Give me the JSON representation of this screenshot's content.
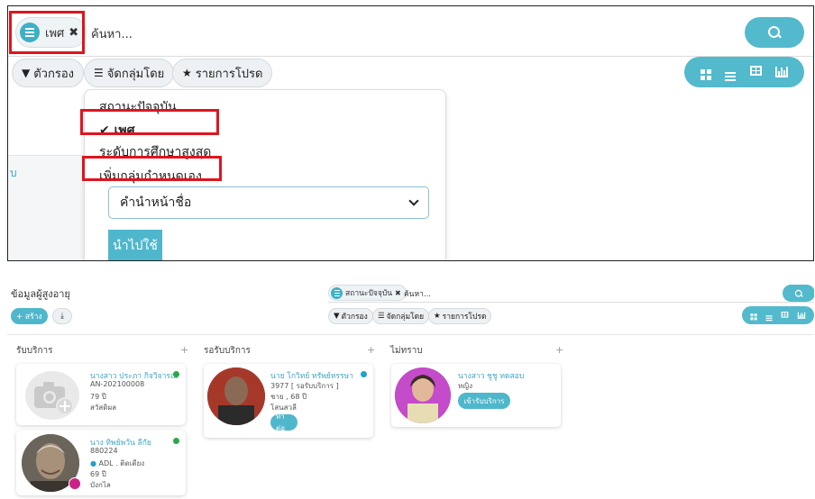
{
  "top": {
    "chip_label": "เพศ",
    "chip_remove": "✖",
    "search_placeholder": "ค้นหา...",
    "filter_label": "ตัวกรอง",
    "group_label": "จัดกลุ่มโดย",
    "favorite_label": "รายการโปรด",
    "side_fragment": "บ",
    "dropdown": {
      "items": [
        "สถานะปัจจุบัน",
        "เพศ",
        "ระดับการศึกษาสูงสุด",
        "เพิ่มกลุ่มกำหนดเอง"
      ],
      "checked_mark": "✔",
      "select_value": "คำนำหน้าชื่อ",
      "apply_label": "นำไปใช้"
    }
  },
  "bottom": {
    "title": "ข้อมูลผู้สูงอายุ",
    "chip_label": "สถานะปัจจุบัน",
    "chip_remove": "✖",
    "search_placeholder": "ค้นหา...",
    "create_label": "+ สร้าง",
    "download_icon": "⤓",
    "filter_label": "ตัวกรอง",
    "group_label": "จัดกลุ่มโดย",
    "favorite_label": "รายการโปรด",
    "columns": [
      {
        "title": "รับบริการ",
        "plus": "+"
      },
      {
        "title": "รอรับบริการ",
        "plus": "+"
      },
      {
        "title": "ไม่ทราบ",
        "plus": "+"
      }
    ],
    "cards": [
      {
        "name": "นางสาว ประภา กิจวิจารณ์",
        "line1": "AN-202100008",
        "line2": "79 ปี",
        "line3": "สวัสดิผล",
        "status_color": "#27a84a"
      },
      {
        "name": "นาง ทิพย์พวัน ลีกัย",
        "line1": "880224",
        "line2": "ADL . ติดเตียง",
        "line3": "69 ปี",
        "line4": "บังกไล",
        "status_color": "#27a84a"
      },
      {
        "name": "นาย โกวิทย์ ทรัพย์หรรษา",
        "line1": "3977 [ รอรับบริการ ]",
        "line2": "ชาย , 68 ปี",
        "line3": "โสนสวลี",
        "action": "ทำต่อ",
        "status_color": "#22a0c8"
      },
      {
        "name": "นางสาว ชูชู ทดสอบ",
        "line1": "หญิง",
        "action": "เข้ารับบริการ"
      }
    ]
  },
  "colors": {
    "accent": "#53b9cc",
    "highlight_box": "#e0141e",
    "link_text": "#3fa6c3"
  }
}
